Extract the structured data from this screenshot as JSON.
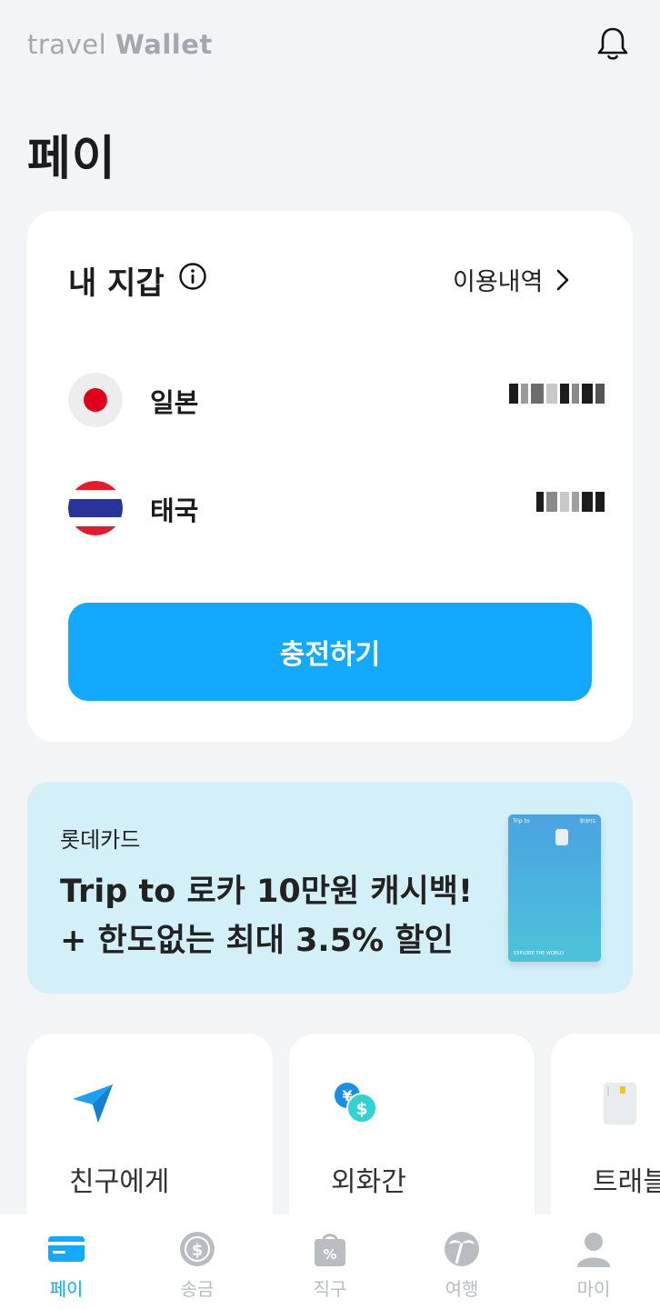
{
  "header": {
    "logo_light": "travel ",
    "logo_bold": "Wallet",
    "notification_icon": "bell-icon"
  },
  "page_title": "페이",
  "wallet": {
    "title": "내 지갑",
    "info_icon": "info-icon",
    "history_label": "이용내역",
    "accounts": [
      {
        "country": "일본",
        "flag_icon": "japan-flag-icon",
        "amount_hidden": true
      },
      {
        "country": "태국",
        "flag_icon": "thailand-flag-icon",
        "amount_hidden": true
      }
    ],
    "charge_label": "충전하기"
  },
  "banner": {
    "brand": "롯데카드",
    "headline_1": "Trip to 로카 10만원 캐시백!",
    "headline_2": "+ 한도없는 최대 3.5% 할인",
    "card_brand": "Trip to",
    "card_issuer": "롯데카드",
    "card_footer": "EXPLORE THE WORLD"
  },
  "features": [
    {
      "label": "친구에게",
      "icon": "send-paper-plane-icon"
    },
    {
      "label": "외화간",
      "icon": "currency-exchange-icon"
    },
    {
      "label": "트래블",
      "icon": "card-icon"
    }
  ],
  "nav": [
    {
      "label": "페이",
      "icon": "card-icon",
      "active": true
    },
    {
      "label": "송금",
      "icon": "dollar-coin-icon",
      "active": false
    },
    {
      "label": "직구",
      "icon": "shopping-bag-percent-icon",
      "active": false
    },
    {
      "label": "여행",
      "icon": "palm-tree-icon",
      "active": false
    },
    {
      "label": "마이",
      "icon": "profile-icon",
      "active": false
    }
  ],
  "colors": {
    "accent": "#12a9ff",
    "background": "#f3f4f6",
    "banner_bg": "#d3eff7",
    "nav_inactive": "#b9bcc1"
  }
}
